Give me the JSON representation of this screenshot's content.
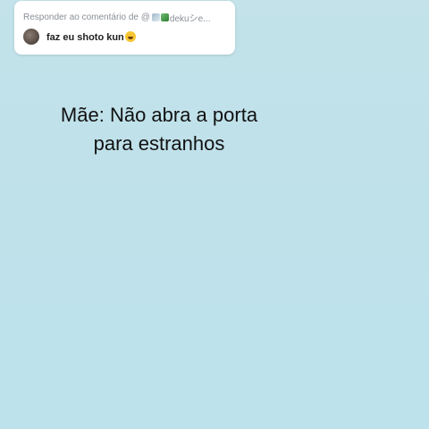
{
  "reply": {
    "header_prefix": "Responder ao comentário de @",
    "header_suffix": "dekuシe...",
    "comment": "faz eu shoto kun",
    "emoji": "grinning-face"
  },
  "caption": {
    "line1": "Mãe: Não abra a porta",
    "line2": "para estranhos"
  },
  "colors": {
    "background": "#c1e1ea",
    "card": "#ffffff",
    "header_text": "#8a8f96",
    "caption_text": "#111111"
  }
}
